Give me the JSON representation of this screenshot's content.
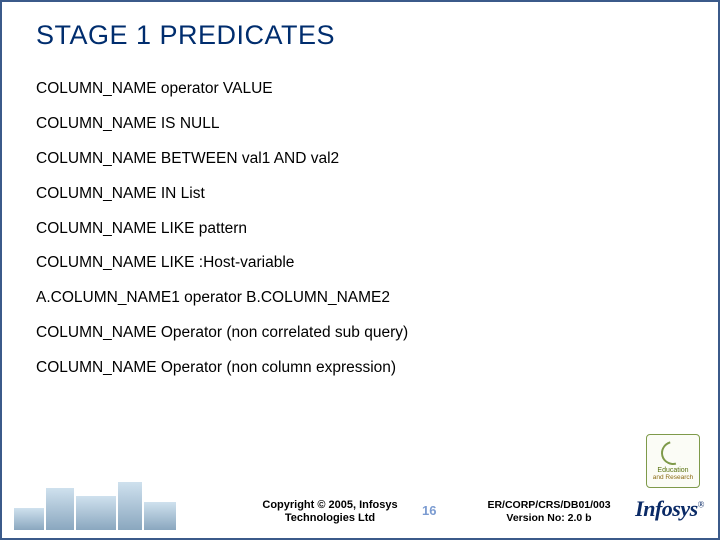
{
  "title": "STAGE 1 PREDICATES",
  "items": [
    "COLUMN_NAME  operator  VALUE",
    "COLUMN_NAME  IS  NULL",
    "COLUMN_NAME  BETWEEN val1 AND val2",
    "COLUMN_NAME  IN List",
    "COLUMN_NAME  LIKE pattern",
    "COLUMN_NAME  LIKE  :Host-variable",
    "A.COLUMN_NAME1 operator B.COLUMN_NAME2",
    "COLUMN_NAME Operator (non correlated sub query)",
    "COLUMN_NAME Operator (non column expression)"
  ],
  "footer": {
    "copyright_line1": "Copyright © 2005, Infosys",
    "copyright_line2": "Technologies Ltd",
    "page_number": "16",
    "doc_line1": "ER/CORP/CRS/DB01/003",
    "doc_line2": "Version No: 2.0 b",
    "badge_line1": "Education",
    "badge_line2": "and Research",
    "brand": "Infosys",
    "reg": "®"
  }
}
